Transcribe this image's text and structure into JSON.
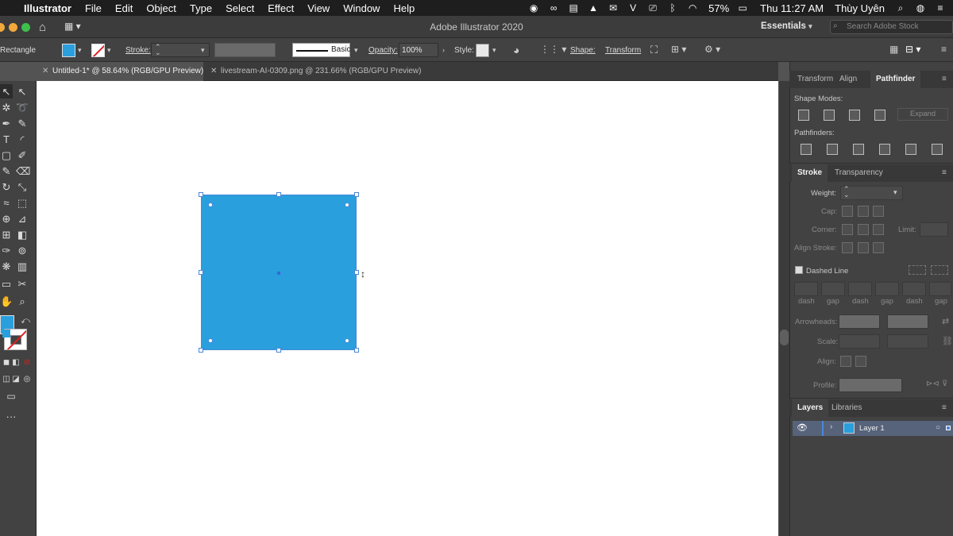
{
  "menubar": {
    "app": "Illustrator",
    "items": [
      "File",
      "Edit",
      "Object",
      "Type",
      "Select",
      "Effect",
      "View",
      "Window",
      "Help"
    ],
    "battery": "57%",
    "clock": "Thu 11:27 AM",
    "user": "Thùy Uyên"
  },
  "titlebar": {
    "title": "Adobe Illustrator 2020",
    "workspace": "Essentials",
    "search_placeholder": "Search Adobe Stock"
  },
  "controlbar": {
    "selection_label": "Rectangle",
    "stroke_label": "Stroke:",
    "brush_style": "Basic",
    "opacity_label": "Opacity:",
    "opacity_value": "100%",
    "style_label": "Style:",
    "shape_label": "Shape:",
    "transform_label": "Transform"
  },
  "tabs": [
    {
      "label": "Untitled-1* @ 58.64% (RGB/GPU Preview)",
      "active": true
    },
    {
      "label": "livestream-AI-0309.png @ 231.66% (RGB/GPU Preview)",
      "active": false
    }
  ],
  "colors": {
    "fill": "#299fde",
    "accent": "#4b87d8"
  },
  "panels": {
    "top_tabs": [
      "Transform",
      "Align",
      "Pathfinder"
    ],
    "shape_modes_label": "Shape Modes:",
    "expand_label": "Expand",
    "pathfinders_label": "Pathfinders:",
    "stroke_tabs": [
      "Stroke",
      "Transparency"
    ],
    "weight_label": "Weight:",
    "cap_label": "Cap:",
    "corner_label": "Corner:",
    "limit_label": "Limit:",
    "align_stroke_label": "Align Stroke:",
    "dashed_line_label": "Dashed Line",
    "dash_labels": [
      "dash",
      "gap",
      "dash",
      "gap",
      "dash",
      "gap"
    ],
    "arrowheads_label": "Arrowheads:",
    "scale_label": "Scale:",
    "align_label": "Align:",
    "profile_label": "Profile:",
    "layer_tabs": [
      "Layers",
      "Libraries"
    ],
    "layer_name": "Layer 1"
  }
}
